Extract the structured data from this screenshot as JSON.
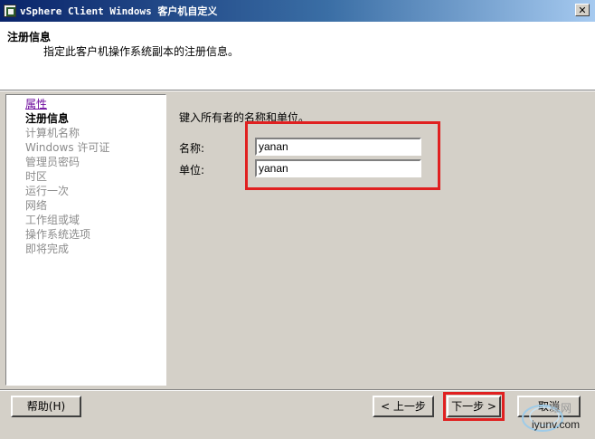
{
  "window": {
    "title": "vSphere Client Windows 客户机自定义",
    "close_glyph": "✕"
  },
  "header": {
    "title": "注册信息",
    "subtitle": "指定此客户机操作系统副本的注册信息。"
  },
  "nav": {
    "items": [
      {
        "label": "属性",
        "state": "link"
      },
      {
        "label": "注册信息",
        "state": "current"
      },
      {
        "label": "计算机名称",
        "state": "disabled"
      },
      {
        "label": "Windows 许可证",
        "state": "disabled"
      },
      {
        "label": "管理员密码",
        "state": "disabled"
      },
      {
        "label": "时区",
        "state": "disabled"
      },
      {
        "label": "运行一次",
        "state": "disabled"
      },
      {
        "label": "网络",
        "state": "disabled"
      },
      {
        "label": "工作组或域",
        "state": "disabled"
      },
      {
        "label": "操作系统选项",
        "state": "disabled"
      },
      {
        "label": "即将完成",
        "state": "disabled"
      }
    ]
  },
  "form": {
    "instruction": "键入所有者的名称和单位。",
    "name_label": "名称:",
    "name_value": "yanan",
    "org_label": "单位:",
    "org_value": "yanan"
  },
  "buttons": {
    "help": "帮助(H)",
    "back": "< 上一步",
    "next": "下一步 >",
    "cancel": "取消"
  },
  "watermark": {
    "text_cn": "维网",
    "text_site": "iyunv.com"
  },
  "colors": {
    "highlight": "#e02020",
    "title_bar": "#0a246a",
    "link": "#6f0c9e"
  }
}
